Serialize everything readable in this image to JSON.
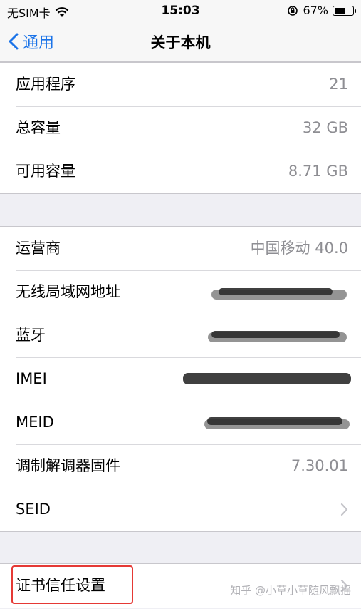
{
  "status_bar": {
    "carrier": "无SIM卡",
    "time": "15:03",
    "battery_percent": "67%",
    "battery_level": 0.67
  },
  "nav": {
    "back_label": "通用",
    "title": "关于本机"
  },
  "group1": [
    {
      "label": "应用程序",
      "value": "21"
    },
    {
      "label": "总容量",
      "value": "32 GB"
    },
    {
      "label": "可用容量",
      "value": "8.71 GB"
    }
  ],
  "group2": [
    {
      "label": "运营商",
      "value": "中国移动 40.0"
    },
    {
      "label": "无线局域网地址",
      "value": ""
    },
    {
      "label": "蓝牙",
      "value": ""
    },
    {
      "label": "IMEI",
      "value": ""
    },
    {
      "label": "MEID",
      "value": ""
    },
    {
      "label": "调制解调器固件",
      "value": "7.30.01"
    },
    {
      "label": "SEID",
      "value": ""
    }
  ],
  "group3": [
    {
      "label": "证书信任设置",
      "value": ""
    }
  ],
  "watermark": "知乎 @小草小草随风飘摇",
  "colors": {
    "accent": "#1a73e8",
    "highlight": "#e53935"
  }
}
